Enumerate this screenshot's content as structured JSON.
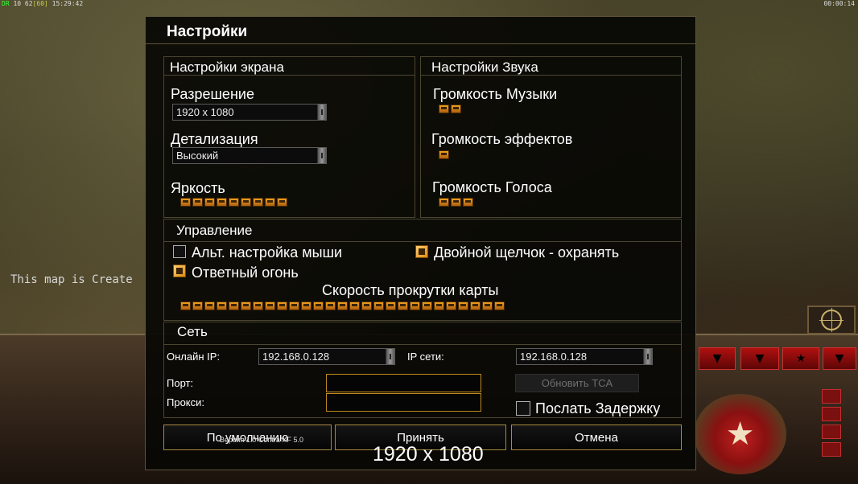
{
  "hud": {
    "fps_a": "DR",
    "fps_b": "10 62",
    "fps_c": "[60]",
    "fps_time": "15:29:42",
    "clock": "00:00:14",
    "map_message": "This map is Create"
  },
  "dialog": {
    "title": "Настройки",
    "screen": {
      "header": "Настройки экрана",
      "resolution_label": "Разрешение",
      "resolution_value": "1920 x 1080",
      "detail_label": "Детализация",
      "detail_value": "Высокий",
      "brightness_label": "Яркость",
      "brightness_level": 0.9
    },
    "sound": {
      "header": "Настройки Звука",
      "music_label": "Громкость Музыки",
      "music_level": 0.2,
      "effects_label": "Громкость эффектов",
      "effects_level": 0.1,
      "voice_label": "Громкость Голоса",
      "voice_level": 0.3
    },
    "controls": {
      "header": "Управление",
      "alt_mouse_label": "Альт. настройка мыши",
      "alt_mouse_checked": false,
      "double_click_label": "Двойной щелчок - охранять",
      "double_click_checked": true,
      "return_fire_label": "Ответный огонь",
      "return_fire_checked": true,
      "scroll_speed_label": "Скорость прокрутки карты",
      "scroll_speed_level": 0.95
    },
    "network": {
      "header": "Сеть",
      "online_ip_label": "Онлайн IP:",
      "online_ip_value": "192.168.0.128",
      "lan_ip_label": "IP сети:",
      "lan_ip_value": "192.168.0.128",
      "port_label": "Порт:",
      "port_value": "",
      "proxy_label": "Прокси:",
      "proxy_value": "",
      "update_tca_label": "Обновить TCA",
      "send_delay_label": "Послать Задержку",
      "send_delay_checked": false
    },
    "buttons": {
      "default": "По умолчанию",
      "accept": "Принять",
      "cancel": "Отмена"
    },
    "version": "Версия 1.0 Contra XF 5.0",
    "resolution_overlay": "1920 x 1080"
  },
  "colors": {
    "accent": "#f0a020",
    "field_border": "#c08a20",
    "panel_border": "#4b4630"
  }
}
